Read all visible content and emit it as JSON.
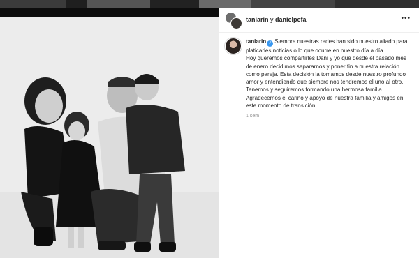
{
  "post": {
    "header": {
      "user1": "taniarin",
      "connector": "y",
      "user2": "danielpefa",
      "more_icon": "more-horizontal-icon"
    },
    "caption": {
      "username": "taniarin",
      "verified_icon": "verified-badge-icon",
      "lines": [
        "Siempre nuestras redes han sido nuestro aliado para platicarles noticias o lo que ocurre en nuestro día a día.",
        "Hoy queremos compartirles Dani y yo que desde el pasado mes de enero decidimos separarnos y poner fin a nuestra relación como pareja. Esta decisión la tomamos desde nuestro profundo amor y entendiendo que siempre nos tendremos el uno al otro.",
        "Tenemos y seguiremos formando una hermosa familia.",
        "Agradecemos el cariño y apoyo de nuestra familia y amigos en este momento de transición."
      ],
      "timestamp": "1 sem"
    }
  },
  "photo": {
    "subject": "black-and-white family photo"
  },
  "colors": {
    "verified": "#3897f0",
    "text": "#262626",
    "muted": "#8e8e8e"
  }
}
